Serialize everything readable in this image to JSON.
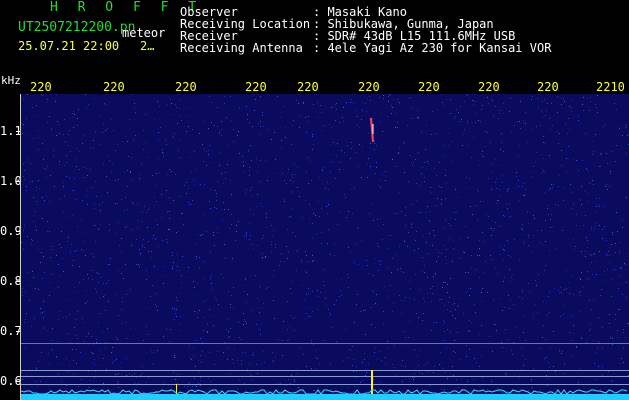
{
  "header": {
    "site_code": "H R O F F T",
    "filename": "UT2507212200.pn",
    "event_type": "meteor",
    "datetime": "25.07.21 22:00",
    "page_indicator": "2…",
    "info_labels": [
      "Observer",
      "Receiving Location",
      "Receiver",
      "Receiving Antenna"
    ],
    "info_values": [
      ": Masaki Kano",
      ": Shibukawa, Gunma, Japan",
      ": SDR# 43dB L15 111.6MHz USB",
      ": 4ele Yagi Az 230 for Kansai VOR"
    ]
  },
  "plot": {
    "y_unit": "kHz",
    "x_ticks": [
      "220",
      "220",
      "220",
      "220",
      "220",
      "220",
      "220",
      "220",
      "220",
      "2210"
    ],
    "y_ticks": [
      "1.1",
      "1.0",
      "0.9",
      "0.8",
      "0.7",
      "0.6"
    ],
    "colors": {
      "background": "#0a0a5e",
      "noise": "#3344cc",
      "baseline": "#22ccff",
      "tick_text": "#ffff33",
      "meteor_echo": "#ff4466"
    }
  }
}
